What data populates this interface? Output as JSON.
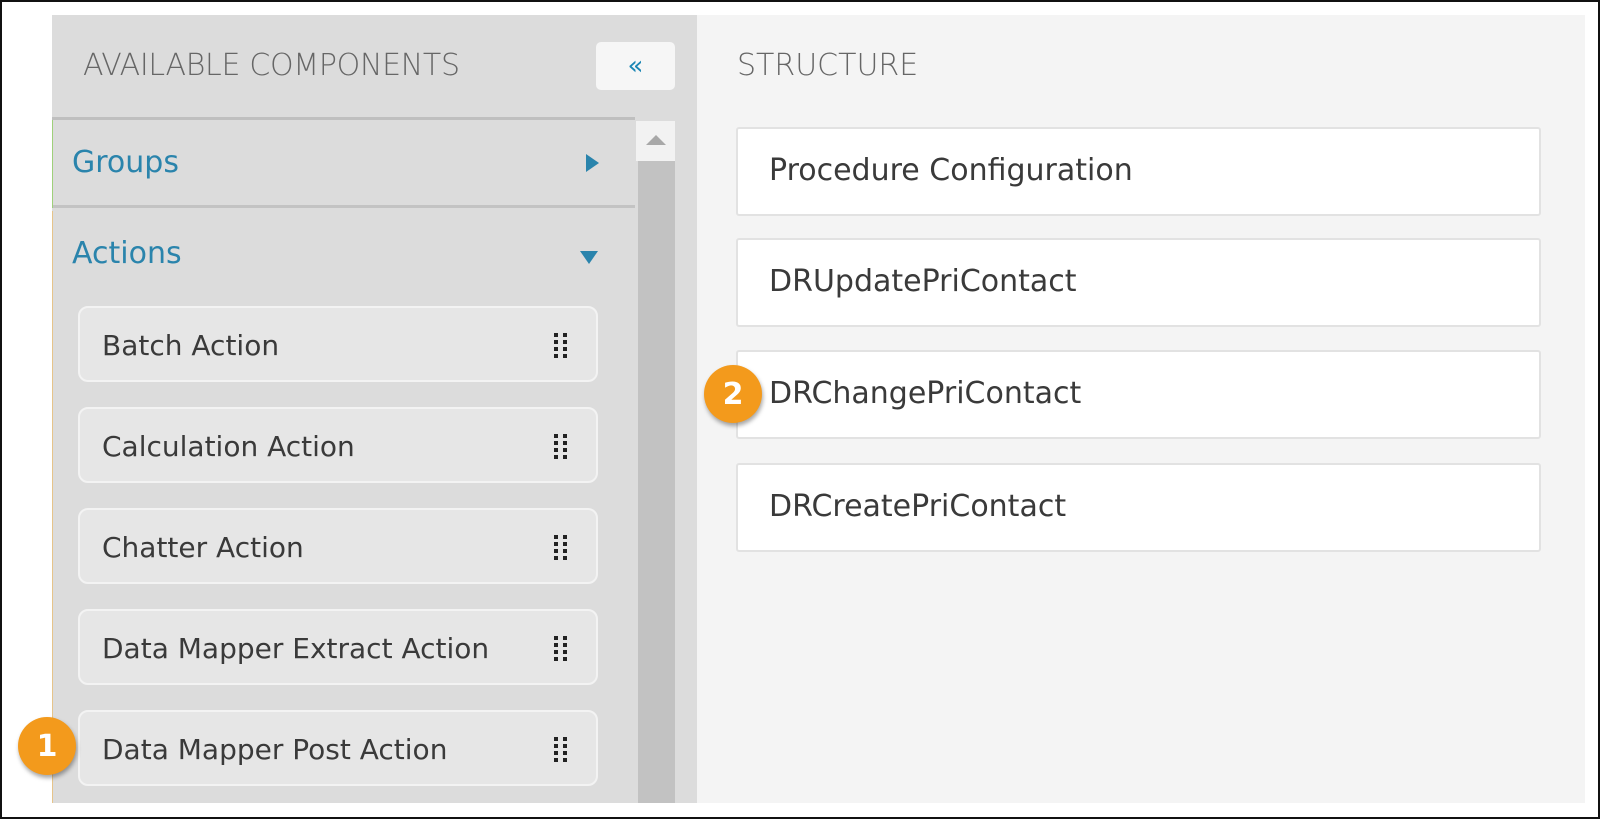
{
  "left_panel": {
    "title": "AVAILABLE COMPONENTS",
    "collapse_icon": "«",
    "groups": {
      "label": "Groups",
      "state": "collapsed"
    },
    "actions": {
      "label": "Actions",
      "state": "expanded",
      "items": [
        {
          "label": "Batch Action"
        },
        {
          "label": "Calculation Action"
        },
        {
          "label": "Chatter Action"
        },
        {
          "label": "Data Mapper Extract Action"
        },
        {
          "label": "Data Mapper Post Action"
        }
      ]
    }
  },
  "right_panel": {
    "title": "STRUCTURE",
    "cards": [
      {
        "label": "Procedure Configuration"
      },
      {
        "label": "DRUpdatePriContact"
      },
      {
        "label": "DRChangePriContact"
      },
      {
        "label": "DRCreatePriContact"
      }
    ]
  },
  "callouts": [
    {
      "number": "1",
      "target": "Data Mapper Post Action"
    },
    {
      "number": "2",
      "target": "DRChangePriContact"
    }
  ],
  "colors": {
    "accent": "#2a84ac",
    "callout": "#f39a1c"
  }
}
